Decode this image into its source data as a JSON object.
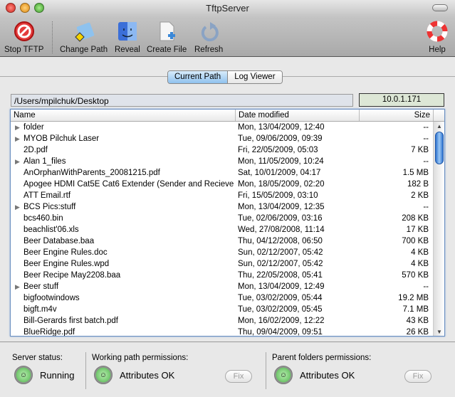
{
  "window": {
    "title": "TftpServer"
  },
  "toolbar": {
    "stop": "Stop TFTP",
    "change_path": "Change Path",
    "reveal": "Reveal",
    "create_file": "Create File",
    "refresh": "Refresh",
    "help": "Help"
  },
  "tabs": {
    "current": "Current Path",
    "log": "Log Viewer"
  },
  "path": "/Users/mpilchuk/Desktop",
  "ip": "10.0.1.171",
  "columns": {
    "name": "Name",
    "date": "Date modified",
    "size": "Size"
  },
  "rows": [
    {
      "name": "folder",
      "folder": true,
      "date": "Mon, 13/04/2009, 12:40",
      "size": "--"
    },
    {
      "name": "MYOB Pilchuk Laser",
      "folder": true,
      "date": "Tue, 09/06/2009, 09:39",
      "size": "--"
    },
    {
      "name": "2D.pdf",
      "date": "Fri, 22/05/2009, 05:03",
      "size": "7 KB"
    },
    {
      "name": "Alan 1_files",
      "folder": true,
      "date": "Mon, 11/05/2009, 10:24",
      "size": "--"
    },
    {
      "name": "AnOrphanWithParents_20081215.pdf",
      "date": "Sat, 10/01/2009, 04:17",
      "size": "1.5 MB"
    },
    {
      "name": "Apogee HDMI Cat5E Cat6 Extender (Sender and Recieve",
      "date": "Mon, 18/05/2009, 02:20",
      "size": "182 B"
    },
    {
      "name": "ATT Email.rtf",
      "date": "Fri, 15/05/2009, 03:10",
      "size": "2 KB"
    },
    {
      "name": "BCS Pics:stuff",
      "folder": true,
      "date": "Mon, 13/04/2009, 12:35",
      "size": "--"
    },
    {
      "name": "bcs460.bin",
      "date": "Tue, 02/06/2009, 03:16",
      "size": "208 KB"
    },
    {
      "name": "beachlist'06.xls",
      "date": "Wed, 27/08/2008, 11:14",
      "size": "17 KB"
    },
    {
      "name": "Beer Database.baa",
      "date": "Thu, 04/12/2008, 06:50",
      "size": "700 KB"
    },
    {
      "name": "Beer Engine Rules.doc",
      "date": "Sun, 02/12/2007, 05:42",
      "size": "4 KB"
    },
    {
      "name": "Beer Engine Rules.wpd",
      "date": "Sun, 02/12/2007, 05:42",
      "size": "4 KB"
    },
    {
      "name": "Beer Recipe May2208.baa",
      "date": "Thu, 22/05/2008, 05:41",
      "size": "570 KB"
    },
    {
      "name": "Beer stuff",
      "folder": true,
      "date": "Mon, 13/04/2009, 12:49",
      "size": "--"
    },
    {
      "name": "bigfootwindows",
      "date": "Tue, 03/02/2009, 05:44",
      "size": "19.2 MB"
    },
    {
      "name": "bigft.m4v",
      "date": "Tue, 03/02/2009, 05:45",
      "size": "7.1 MB"
    },
    {
      "name": "Bill-Gerards first batch.pdf",
      "date": "Mon, 16/02/2009, 12:22",
      "size": "43 KB"
    },
    {
      "name": "BlueRidge.pdf",
      "date": "Thu, 09/04/2009, 09:51",
      "size": "26 KB"
    }
  ],
  "status": {
    "server_label": "Server status:",
    "server_value": "Running",
    "working_label": "Working path permissions:",
    "working_value": "Attributes OK",
    "parent_label": "Parent folders permissions:",
    "parent_value": "Attributes OK",
    "fix": "Fix"
  }
}
